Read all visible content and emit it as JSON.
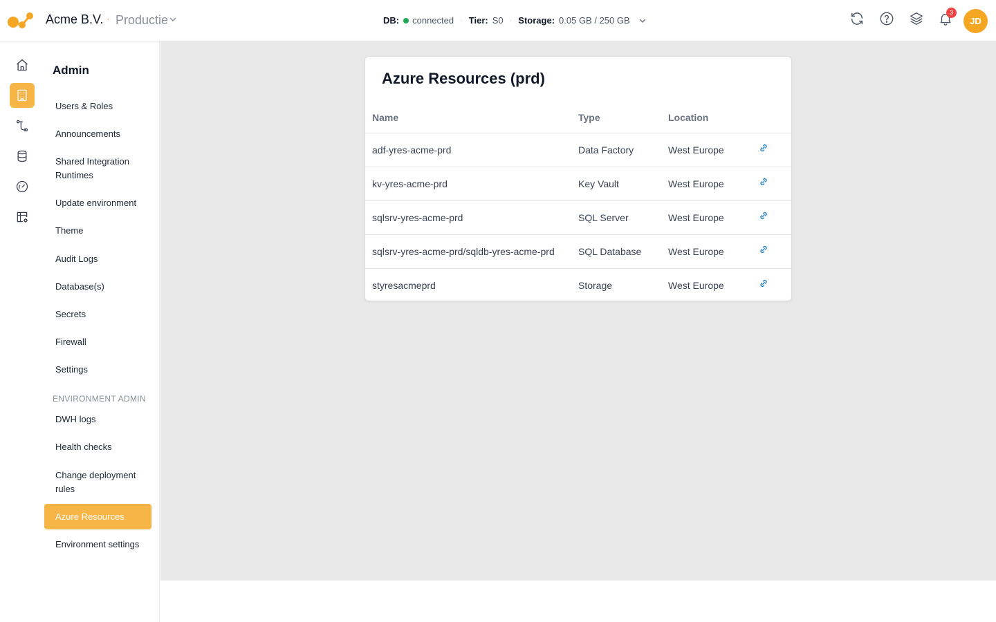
{
  "header": {
    "org_name": "Acme B.V.",
    "separator": "·",
    "environment": "Productie",
    "status": {
      "db_label": "DB:",
      "db_value": "connected",
      "tier_label": "Tier:",
      "tier_value": "S0",
      "storage_label": "Storage:",
      "storage_value": "0.05 GB / 250 GB"
    },
    "icons": [
      "refresh-icon",
      "help-icon",
      "layers-icon",
      "bell-icon"
    ],
    "notification_count": "3",
    "avatar_initials": "JD"
  },
  "rail": {
    "items": [
      "home-icon",
      "building-icon",
      "workflow-icon",
      "database-icon",
      "gauge-icon",
      "table-settings-icon"
    ],
    "active_index": 1
  },
  "sidebar": {
    "title": "Admin",
    "items": [
      {
        "label": "Users & Roles"
      },
      {
        "label": "Announcements"
      },
      {
        "label": "Shared Integration Runtimes"
      },
      {
        "label": "Update environment"
      },
      {
        "label": "Theme"
      },
      {
        "label": "Audit Logs"
      },
      {
        "label": "Database(s)"
      },
      {
        "label": "Secrets"
      },
      {
        "label": "Firewall"
      },
      {
        "label": "Settings"
      }
    ],
    "section_label": "ENVIRONMENT ADMIN",
    "env_items": [
      {
        "label": "DWH logs"
      },
      {
        "label": "Health checks"
      },
      {
        "label": "Change deployment rules"
      },
      {
        "label": "Azure Resources",
        "active": true
      },
      {
        "label": "Environment settings"
      }
    ]
  },
  "card": {
    "title": "Azure Resources (prd)",
    "columns": [
      "Name",
      "Type",
      "Location"
    ],
    "rows": [
      {
        "name": "adf-yres-acme-prd",
        "type": "Data Factory",
        "location": "West Europe"
      },
      {
        "name": "kv-yres-acme-prd",
        "type": "Key Vault",
        "location": "West Europe"
      },
      {
        "name": "sqlsrv-yres-acme-prd",
        "type": "SQL Server",
        "location": "West Europe"
      },
      {
        "name": "sqlsrv-yres-acme-prd/sqldb-yres-acme-prd",
        "type": "SQL Database",
        "location": "West Europe"
      },
      {
        "name": "styresacmeprd",
        "type": "Storage",
        "location": "West Europe"
      }
    ]
  },
  "colors": {
    "accent": "#f8b547",
    "brand_orange": "#f5a623",
    "connected_green": "#22a855",
    "badge_red": "#ef4444",
    "link_blue": "#1f7fc4"
  }
}
